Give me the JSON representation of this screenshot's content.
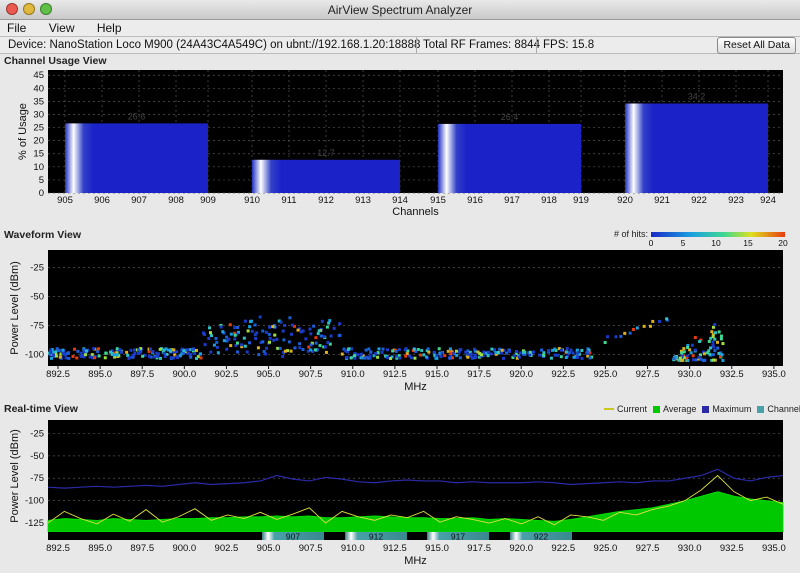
{
  "window": {
    "title": "AirView Spectrum Analyzer"
  },
  "menu": {
    "items": [
      "File",
      "View",
      "Help"
    ]
  },
  "status": {
    "device": "Device: NanoStation Loco M900 (24A43C4A549C) on ubnt://192.168.1.20:18888",
    "frames": "Total RF Frames: 8844",
    "fps": "FPS: 15.8",
    "reset_label": "Reset All Data"
  },
  "colors": {
    "bar": "#1a22c8",
    "density_low": "#1a3cc8",
    "density_high": "#e83a10",
    "average": "#00c800",
    "current": "#e0e040",
    "maximum": "#2a2aa8",
    "channels": "#4aa0a8"
  },
  "channel_usage": {
    "title": "Channel Usage View",
    "chart_data": {
      "type": "bar",
      "ylabel": "% of Usage",
      "xlabel": "Channels",
      "ylim": [
        0,
        47
      ],
      "y_ticks": [
        "0",
        "5",
        "10",
        "15",
        "20",
        "25",
        "30",
        "35",
        "40",
        "45"
      ],
      "x_ticks": [
        "905",
        "906",
        "907",
        "908",
        "909",
        "910",
        "911",
        "912",
        "913",
        "914",
        "915",
        "916",
        "917",
        "918",
        "919",
        "920",
        "921",
        "922",
        "923",
        "924"
      ],
      "categories": [
        "905-909",
        "910-914",
        "915-919",
        "920-924"
      ],
      "values": [
        26.6,
        12.7,
        26.4,
        34.2
      ],
      "labels": [
        "26.6",
        "12.7",
        "26.4",
        "34.2"
      ]
    }
  },
  "waveform": {
    "title": "Waveform View",
    "legend_title": "# of hits:",
    "legend_ticks": [
      "0",
      "5",
      "10",
      "15",
      "20"
    ],
    "chart_data": {
      "type": "heatmap",
      "ylabel": "Power Level (dBm)",
      "xlabel": "MHz",
      "xlim": [
        902.0,
        928.0
      ],
      "ylim": [
        -110,
        -10
      ],
      "y_ticks": [
        "-25",
        "-50",
        "-75",
        "-100"
      ],
      "x_ticks": [
        "892.5",
        "895.0",
        "897.5",
        "900.0",
        "902.5",
        "905.0",
        "907.5",
        "910.0",
        "912.5",
        "915.0",
        "917.5",
        "920.0",
        "922.5",
        "925.0",
        "927.5",
        "930.0",
        "932.5",
        "935.0"
      ]
    }
  },
  "realtime": {
    "title": "Real-time View",
    "legend": [
      "Current",
      "Average",
      "Maximum",
      "Channels"
    ],
    "channel_labels": [
      "907",
      "912",
      "917",
      "922"
    ],
    "chart_data": {
      "type": "area",
      "ylabel": "Power Level (dBm)",
      "xlabel": "MHz",
      "xlim": [
        902.0,
        928.0
      ],
      "ylim": [
        -135,
        -10
      ],
      "y_ticks": [
        "-25",
        "-50",
        "-75",
        "-100",
        "-125"
      ],
      "x_ticks": [
        "892.5",
        "895.0",
        "897.5",
        "900.0",
        "902.5",
        "905.0",
        "907.5",
        "910.0",
        "912.5",
        "915.0",
        "917.5",
        "920.0",
        "922.5",
        "925.0",
        "927.5",
        "930.0",
        "932.5",
        "935.0"
      ],
      "x": [
        892,
        893,
        894,
        895,
        896,
        897,
        898,
        899,
        900,
        901,
        902,
        903,
        904,
        905,
        906,
        907,
        908,
        909,
        910,
        911,
        912,
        913,
        914,
        915,
        916,
        917,
        918,
        919,
        920,
        921,
        922,
        923,
        924,
        925,
        926,
        927,
        928,
        929,
        930,
        931,
        932,
        933,
        934,
        935,
        936,
        937
      ],
      "series": [
        {
          "name": "Average",
          "values": [
            -122,
            -120,
            -121,
            -122,
            -120,
            -121,
            -122,
            -121,
            -120,
            -120,
            -119,
            -119,
            -118,
            -118,
            -117,
            -118,
            -117,
            -119,
            -119,
            -118,
            -117,
            -118,
            -119,
            -119,
            -120,
            -120,
            -119,
            -121,
            -120,
            -121,
            -122,
            -123,
            -121,
            -118,
            -115,
            -112,
            -110,
            -108,
            -104,
            -100,
            -95,
            -90,
            -95,
            -98,
            -100,
            -102
          ]
        },
        {
          "name": "Current",
          "values": [
            -125,
            -112,
            -120,
            -126,
            -115,
            -123,
            -110,
            -124,
            -118,
            -109,
            -122,
            -116,
            -120,
            -113,
            -121,
            -115,
            -108,
            -125,
            -112,
            -118,
            -122,
            -116,
            -119,
            -112,
            -124,
            -118,
            -121,
            -125,
            -120,
            -126,
            -118,
            -127,
            -116,
            -118,
            -122,
            -113,
            -116,
            -110,
            -106,
            -100,
            -88,
            -72,
            -90,
            -100,
            -96,
            -104
          ]
        },
        {
          "name": "Maximum",
          "values": [
            -85,
            -86,
            -85,
            -84,
            -85,
            -84,
            -83,
            -84,
            -82,
            -80,
            -82,
            -81,
            -80,
            -78,
            -72,
            -76,
            -78,
            -74,
            -76,
            -79,
            -80,
            -78,
            -77,
            -78,
            -78,
            -80,
            -79,
            -80,
            -80,
            -80,
            -79,
            -80,
            -82,
            -81,
            -80,
            -79,
            -80,
            -78,
            -78,
            -75,
            -72,
            -65,
            -75,
            -78,
            -74,
            -72
          ]
        }
      ]
    }
  }
}
